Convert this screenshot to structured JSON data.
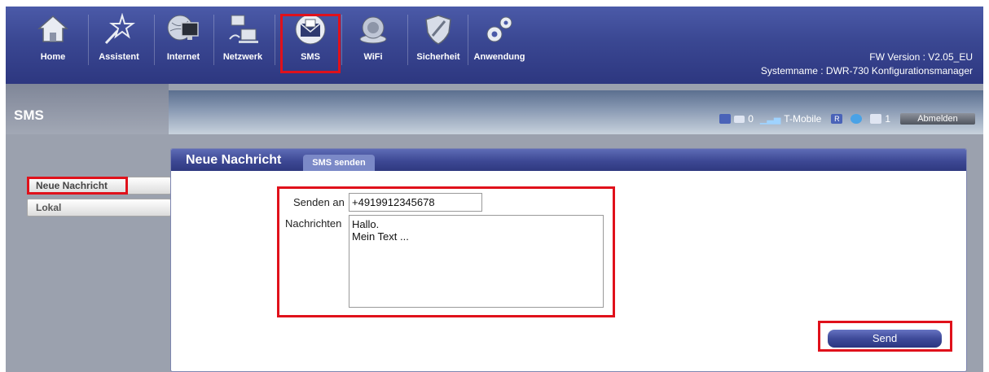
{
  "nav": {
    "items": [
      {
        "label": "Home",
        "icon": "home-icon"
      },
      {
        "label": "Assistent",
        "icon": "wizard-icon"
      },
      {
        "label": "Internet",
        "icon": "internet-icon"
      },
      {
        "label": "Netzwerk",
        "icon": "network-icon"
      },
      {
        "label": "SMS",
        "icon": "sms-icon"
      },
      {
        "label": "WiFi",
        "icon": "wifi-icon"
      },
      {
        "label": "Sicherheit",
        "icon": "security-icon"
      },
      {
        "label": "Anwendung",
        "icon": "gears-icon"
      }
    ],
    "active": "SMS"
  },
  "device": {
    "fw_version": "FW Version : V2.05_EU",
    "system_name": "Systemname : DWR-730 Konfigurationsmanager"
  },
  "section": {
    "title": "SMS"
  },
  "status": {
    "unread_sms": "0",
    "operator": "T-Mobile",
    "roaming": "R",
    "connected_clients": "1",
    "logout_label": "Abmelden"
  },
  "sidebar": {
    "items": [
      {
        "label": "Neue Nachricht"
      },
      {
        "label": "Lokal"
      }
    ]
  },
  "panel": {
    "title": "Neue Nachricht",
    "tab_label": "SMS senden"
  },
  "form": {
    "to_label": "Senden an",
    "to_value": "+4919912345678",
    "message_label": "Nachrichten",
    "message_value": "Hallo.\nMein Text ...",
    "send_label": "Send"
  },
  "colors": {
    "accent": "#3a4792",
    "highlight": "#e0111b"
  }
}
